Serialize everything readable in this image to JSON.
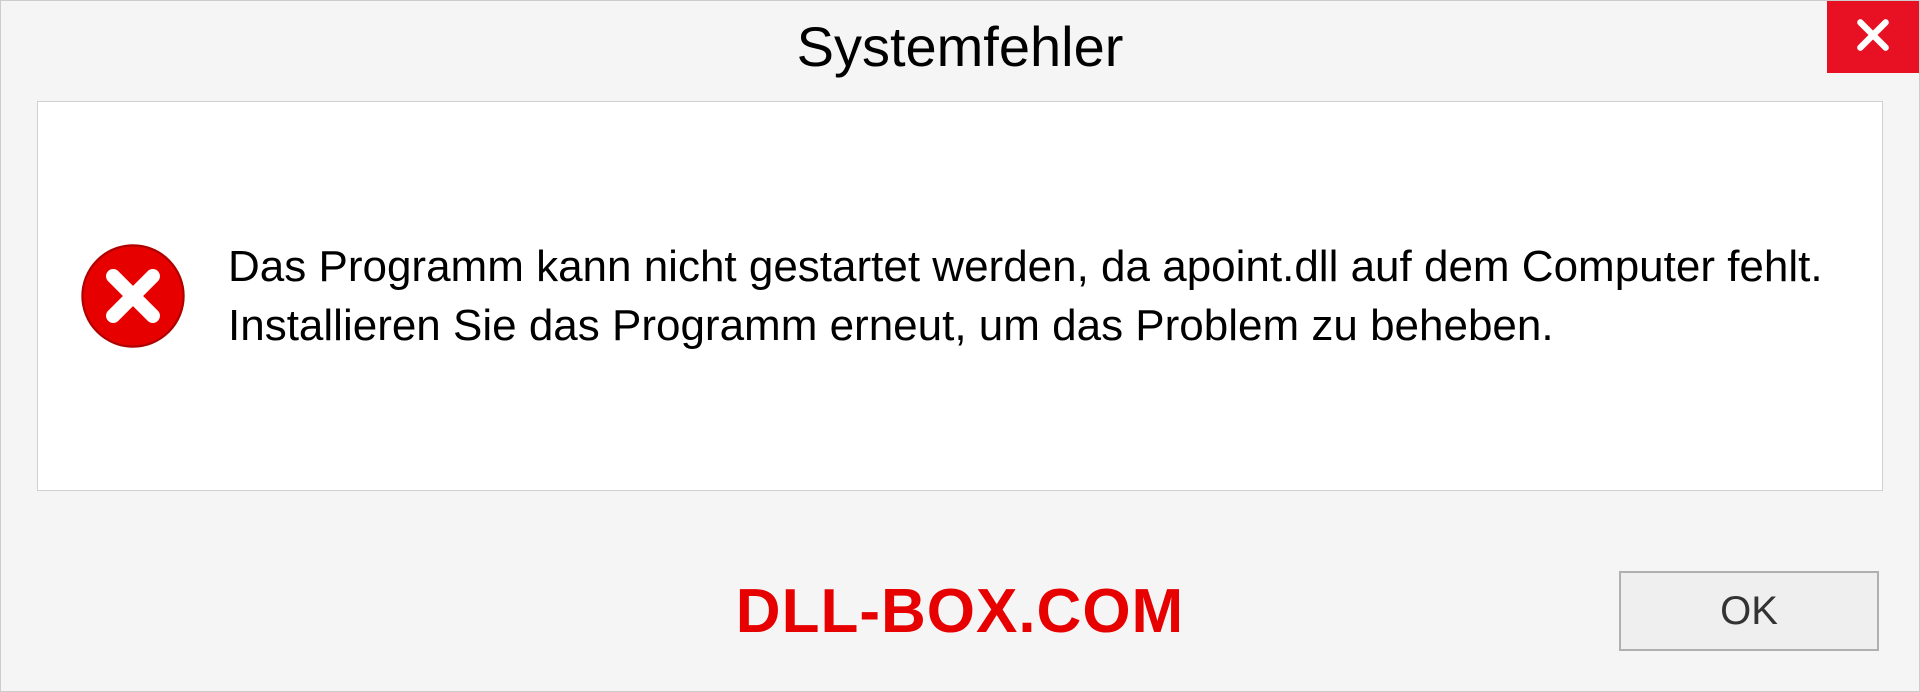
{
  "dialog": {
    "title": "Systemfehler",
    "message": "Das Programm kann nicht gestartet werden, da apoint.dll auf dem Computer fehlt. Installieren Sie das Programm erneut, um das Problem zu beheben.",
    "ok_label": "OK"
  },
  "watermark": "DLL-BOX.COM"
}
